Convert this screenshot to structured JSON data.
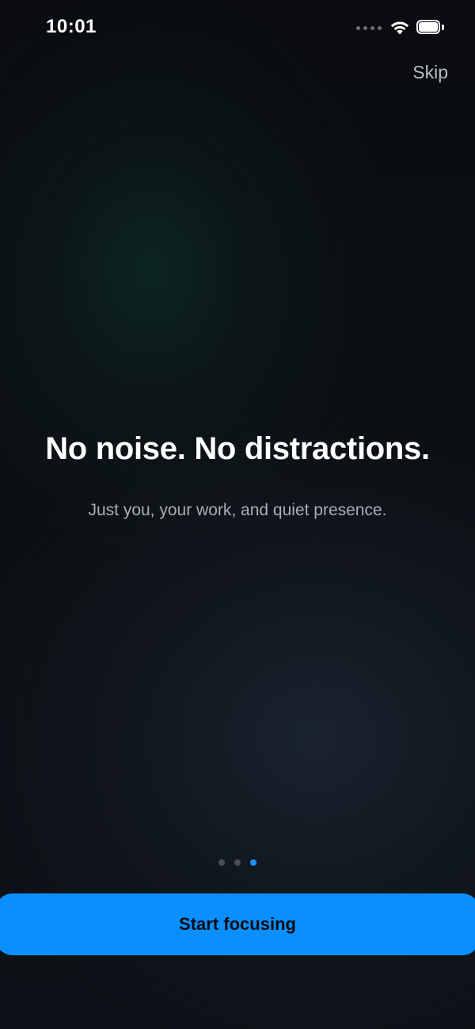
{
  "status_bar": {
    "time": "10:01",
    "wifi_icon": "wifi-icon",
    "battery_icon": "battery-icon",
    "signal_icon": "cellular-signal-dots-icon"
  },
  "header": {
    "skip_label": "Skip"
  },
  "content": {
    "headline": "No noise. No distractions.",
    "subtitle": "Just you, your work, and quiet presence."
  },
  "pagination": {
    "total_pages": 3,
    "current_page": 3,
    "active_color": "#1f8fff",
    "inactive_color": "#4b5058"
  },
  "cta": {
    "label": "Start focusing",
    "color": "#0a8fff"
  }
}
